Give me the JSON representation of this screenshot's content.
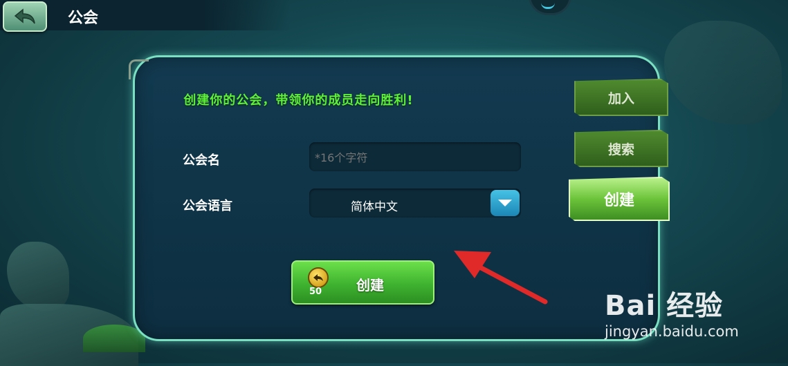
{
  "header": {
    "title": "公会"
  },
  "panel": {
    "headline": "创建你的公会，带领你的成员走向胜利!",
    "name_label": "公会名",
    "name_placeholder": "*16个字符",
    "language_label": "公会语言",
    "language_value": "简体中文",
    "create_cost": "50",
    "create_label": "创建"
  },
  "side_tabs": [
    {
      "label": "加入",
      "active": false
    },
    {
      "label": "搜索",
      "active": false
    },
    {
      "label": "创建",
      "active": true
    }
  ],
  "watermark": {
    "logo": "Bai 经验",
    "url": "jingyan.baidu.com"
  },
  "colors": {
    "headline": "#5ef03a",
    "accent_button": "#3fb230",
    "arrow": "#e02a2a"
  }
}
